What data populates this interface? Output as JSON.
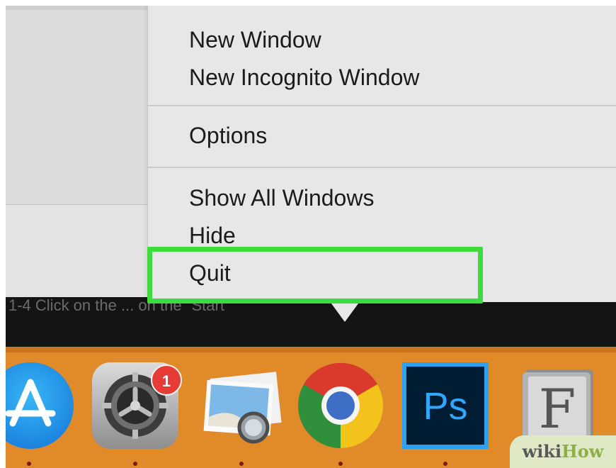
{
  "menu": {
    "items": [
      {
        "label": "New Window"
      },
      {
        "label": "New Incognito Window"
      },
      {
        "label": "Options"
      },
      {
        "label": "Show All Windows"
      },
      {
        "label": "Hide"
      },
      {
        "label": "Quit"
      }
    ]
  },
  "background": {
    "caption_fragment": "1-4 Click on the ... on the \"Start"
  },
  "dock": {
    "apps": [
      {
        "name": "App Store",
        "icon": "app-store-icon"
      },
      {
        "name": "System Preferences",
        "icon": "system-preferences-icon",
        "badge": "1"
      },
      {
        "name": "Preview",
        "icon": "preview-icon"
      },
      {
        "name": "Google Chrome",
        "icon": "chrome-icon"
      },
      {
        "name": "Photoshop",
        "icon": "photoshop-icon",
        "label": "Ps"
      },
      {
        "name": "Font Book",
        "icon": "font-book-icon",
        "label": "F"
      }
    ]
  },
  "watermark": {
    "part1": "wiki",
    "part2": "How"
  },
  "colors": {
    "highlight": "#3bdc3b",
    "dock": "#e08a2a",
    "menu_bg": "#e7e7e7",
    "badge": "#e73c35"
  }
}
